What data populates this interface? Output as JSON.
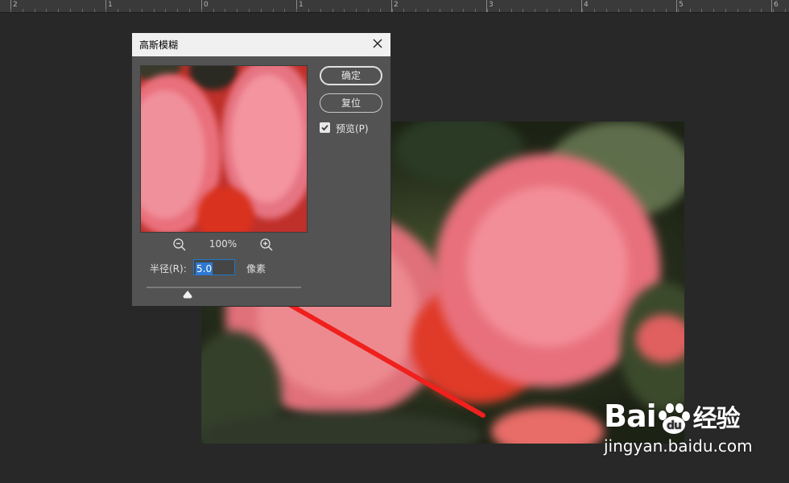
{
  "ruler": {
    "numbers": [
      "2",
      "1",
      "0",
      "1",
      "2",
      "3",
      "4",
      "5",
      "6"
    ]
  },
  "dialog": {
    "title": "高斯模糊",
    "close_icon": "close-icon",
    "ok_label": "确定",
    "reset_label": "复位",
    "preview_label": "预览(P)",
    "preview_checked": true,
    "zoom_out_icon": "zoom-out-icon",
    "zoom_in_icon": "zoom-in-icon",
    "zoom_level": "100%",
    "radius_label": "半径(R):",
    "radius_value": "5.0",
    "radius_unit": "像素",
    "slider_icon": "slider-thumb-icon"
  },
  "watermark": {
    "brand_latin": "Bai",
    "brand_du": "du",
    "brand_cn": "经验",
    "url": "jingyan.baidu.com"
  },
  "colors": {
    "workspace_bg": "#282828",
    "dialog_bg": "#535353",
    "titlebar_bg": "#f0f0f0",
    "input_highlight": "#2e78d2",
    "arrow_red": "#f0201c"
  }
}
